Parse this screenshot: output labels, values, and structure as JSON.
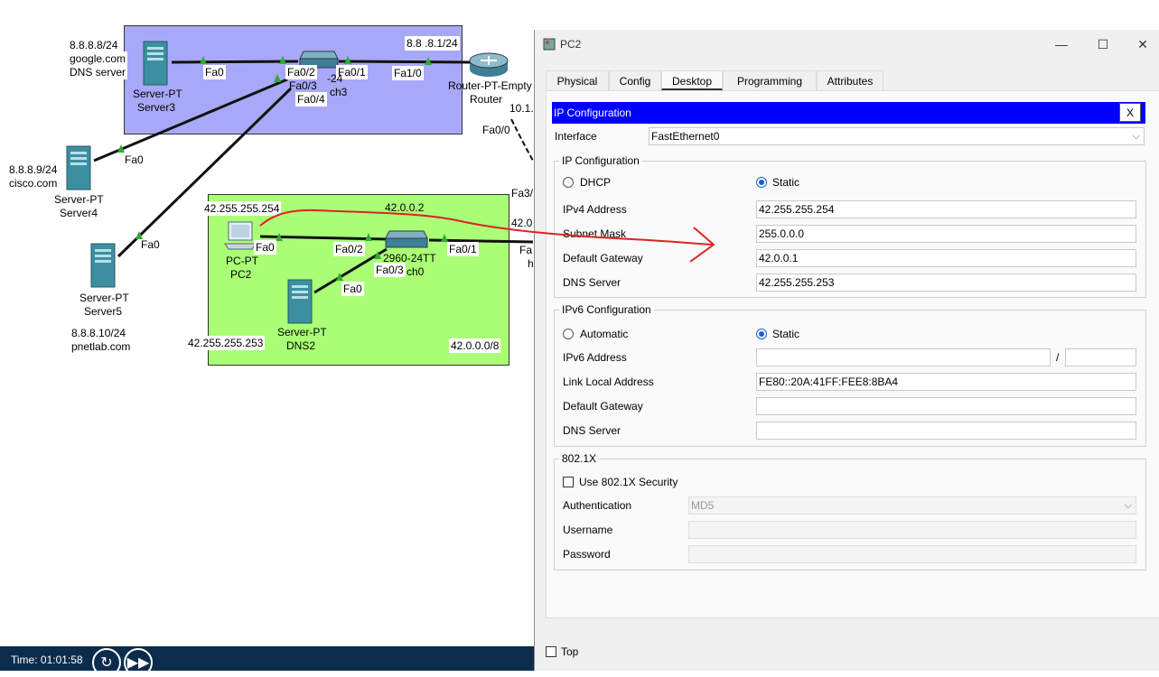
{
  "topology": {
    "server3": {
      "ip": "8.8.8.8/24",
      "domain": "google.com",
      "role": "DNS server",
      "type": "Server-PT",
      "name": "Server3",
      "port": "Fa0"
    },
    "server4": {
      "ip": "8.8.8.9/24",
      "domain": "cisco.com",
      "type": "Server-PT",
      "name": "Server4",
      "port": "Fa0"
    },
    "server5": {
      "ip": "8.8.8.10/24",
      "domain": "pnetlab.com",
      "type": "Server-PT",
      "name": "Server5",
      "port": "Fa0"
    },
    "switch3": {
      "name": "ch3",
      "model": "-24",
      "ports": [
        "Fa0/2",
        "Fa0/3",
        "Fa0/4",
        "Fa0/1"
      ]
    },
    "router": {
      "label": "Router-PT-Empty",
      "name": "Router",
      "port_fa10": "Fa1/0",
      "port_fa00": "Fa0/0",
      "ip_left": "8.8 .8.1/24",
      "ip_bottom": "10.1."
    },
    "green": {
      "pc_ip": "42.255.255.254",
      "switch_ip": "42.0.0.2",
      "dns_ip": "42.255.255.253",
      "network": "42.0.0.0/8",
      "fa3": "Fa3/",
      "ip42": "42.0",
      "fa_partial": "Fa",
      "h_partial": "h"
    },
    "pc2": {
      "type": "PC-PT",
      "name": "PC2",
      "port": "Fa0"
    },
    "switch0": {
      "model": "2960-24TT",
      "name": "ch0",
      "ports": [
        "Fa0/2",
        "Fa0/3",
        "Fa0/1"
      ]
    },
    "dns2": {
      "type": "Server-PT",
      "name": "DNS2",
      "port": "Fa0"
    }
  },
  "statusbar": {
    "time": "Time: 01:01:58",
    "reset_icon": "reset-icon",
    "fastforward_icon": "fast-forward-icon"
  },
  "dialog": {
    "title": "PC2",
    "tabs": [
      "Physical",
      "Config",
      "Desktop",
      "Programming",
      "Attributes"
    ],
    "active_tab": "Desktop",
    "ipconfig": {
      "title": "IP Configuration",
      "close": "X",
      "interface_label": "Interface",
      "interface_value": "FastEthernet0",
      "ipv4_group": "IP Configuration",
      "dhcp": "DHCP",
      "static": "Static",
      "ipv4_label": "IPv4 Address",
      "ipv4_value": "42.255.255.254",
      "mask_label": "Subnet Mask",
      "mask_value": "255.0.0.0",
      "gw_label": "Default Gateway",
      "gw_value": "42.0.0.1",
      "dns_label": "DNS Server",
      "dns_value": "42.255.255.253",
      "ipv6_group": "IPv6 Configuration",
      "automatic": "Automatic",
      "static6": "Static",
      "ipv6_label": "IPv6 Address",
      "ipv6_value": "",
      "slash": "/",
      "prefix_value": "",
      "lla_label": "Link Local Address",
      "lla_value": "FE80::20A:41FF:FEE8:8BA4",
      "gw6_label": "Default Gateway",
      "gw6_value": "",
      "dns6_label": "DNS Server",
      "dns6_value": "",
      "dot1x_group": "802.1X",
      "use_dot1x": "Use 802.1X Security",
      "auth_label": "Authentication",
      "auth_value": "MD5",
      "user_label": "Username",
      "pass_label": "Password"
    },
    "top_checkbox": "Top"
  }
}
